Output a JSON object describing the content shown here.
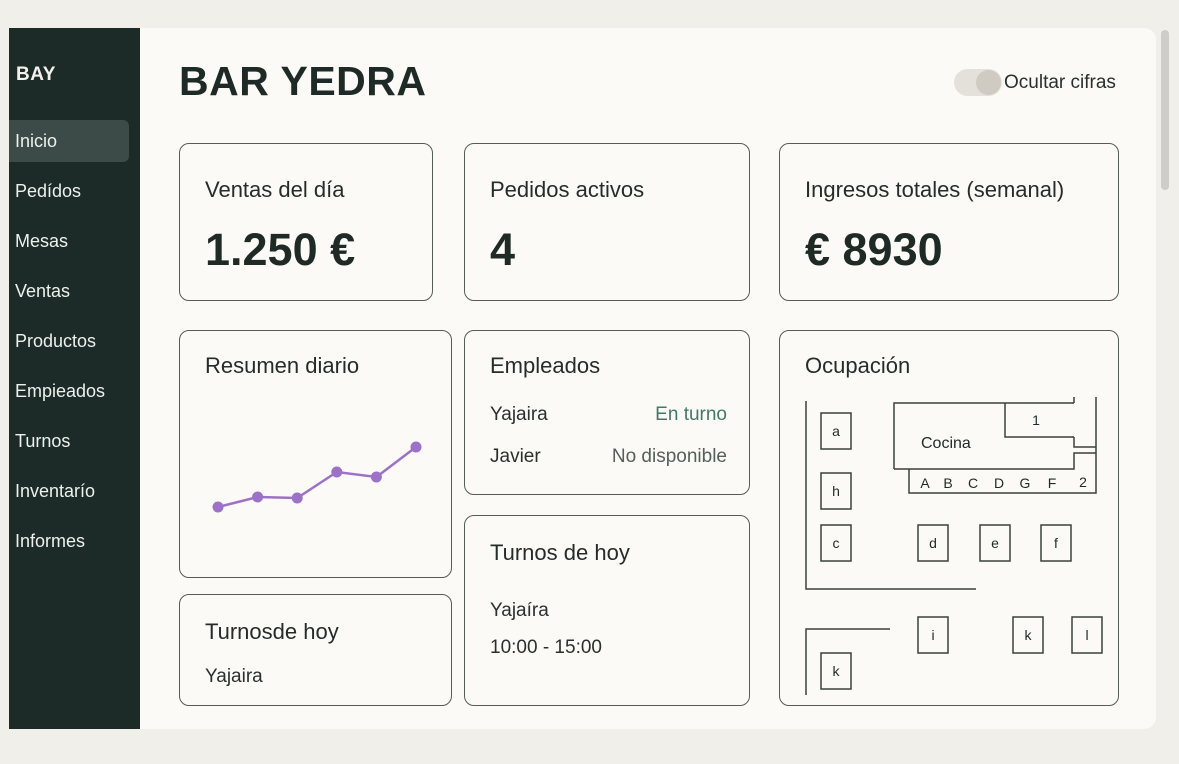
{
  "sidebar": {
    "brand": "BAY",
    "items": [
      {
        "label": "Inicio",
        "active": true
      },
      {
        "label": "Pedídos"
      },
      {
        "label": "Mesas"
      },
      {
        "label": "Ventas"
      },
      {
        "label": "Productos"
      },
      {
        "label": "Empieados"
      },
      {
        "label": "Turnos"
      },
      {
        "label": "Inventarío"
      },
      {
        "label": "Informes"
      }
    ]
  },
  "header": {
    "title": "BAR YEDRA",
    "toggle_label": "Ocultar cifras"
  },
  "kpis": [
    {
      "title": "Ventas del día",
      "value": "1.250 €"
    },
    {
      "title": "Pedidos activos",
      "value": "4"
    },
    {
      "title": "Ingresos totales (semanal)",
      "value": "€ 8930"
    }
  ],
  "summary": {
    "title": "Resumen diario",
    "line_color": "#9b72c7",
    "chart_data": {
      "type": "line",
      "x": [
        1,
        2,
        3,
        4,
        5,
        6
      ],
      "y": [
        2.0,
        3.0,
        2.9,
        5.5,
        5.0,
        8.0
      ]
    }
  },
  "employees": {
    "title": "Empleados",
    "rows": [
      {
        "name": "Yajaira",
        "status": "En turno",
        "color": "#3f7a64"
      },
      {
        "name": "Javier",
        "status": "No disponible",
        "color": "#55605c"
      }
    ]
  },
  "shifts_small": {
    "title": "Turnosde hoy",
    "name": "Yajaira"
  },
  "shifts": {
    "title": "Turnos de hoy",
    "name": "Yajaíra",
    "time": "10:00 - 15:00"
  },
  "occupancy": {
    "title": "Ocupación",
    "kitchen": "Cocina",
    "labels": {
      "one": "1",
      "two": "2",
      "bar": [
        "A",
        "B",
        "C",
        "D",
        "G",
        "F"
      ]
    },
    "tables": [
      "a",
      "h",
      "c",
      "d",
      "e",
      "f",
      "i",
      "k",
      "l",
      "k"
    ]
  }
}
